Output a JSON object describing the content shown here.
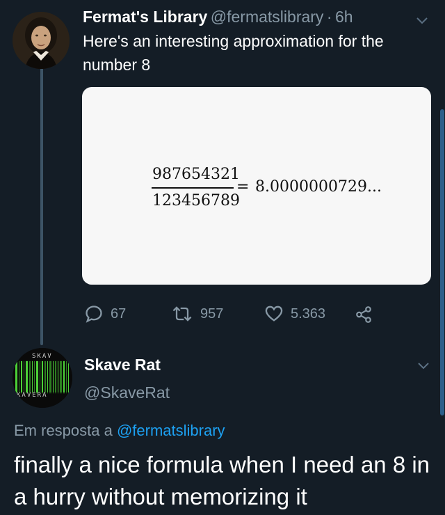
{
  "tweet": {
    "author_name": "Fermat's Library",
    "author_handle": "@fermatslibrary",
    "separator": "·",
    "time": "6h",
    "text": "Here's an interesting approximation for the number 8",
    "math": {
      "numerator": "987654321",
      "denominator": "123456789",
      "equals": "=",
      "result": "8.0000000729",
      "ellipsis": "..."
    },
    "actions": {
      "replies": "67",
      "retweets": "957",
      "likes": "5.363"
    }
  },
  "reply": {
    "author_name": "Skave Rat",
    "author_handle": "@SkaveRat",
    "avatar_top_text": "SKAV",
    "avatar_bottom_text": "KAVERA",
    "reply_prefix": "Em resposta a",
    "reply_to": "@fermatslibrary",
    "text": "finally a nice formula when I need an 8 in a hurry without memorizing it"
  },
  "colors": {
    "background": "#141d26",
    "secondary_text": "#8899a6",
    "link": "#1da1f2",
    "avatar_green": "#4cd137"
  },
  "icons": [
    "caret-down-icon",
    "reply-icon",
    "retweet-icon",
    "like-icon",
    "share-icon"
  ]
}
